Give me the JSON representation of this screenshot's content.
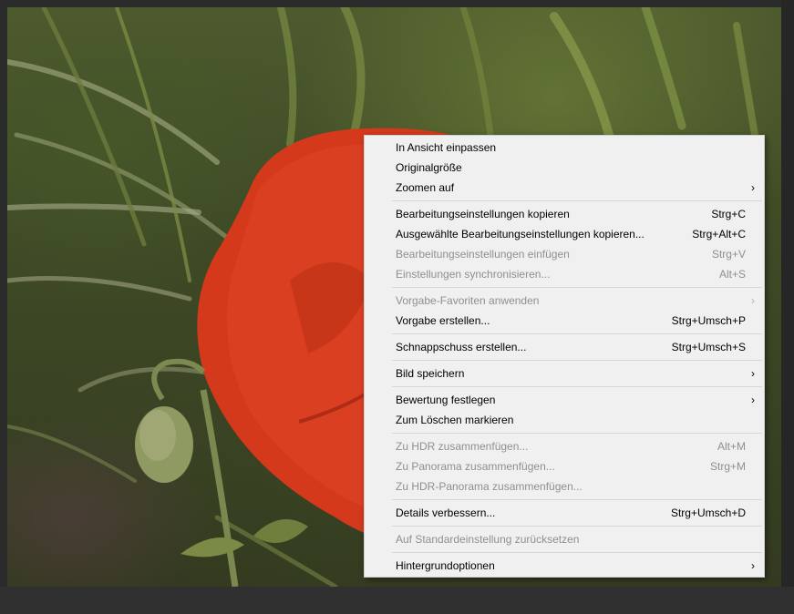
{
  "photo": {
    "subject": "red-poppy-flower"
  },
  "colors": {
    "menu_bg": "#f0f0f0",
    "menu_text": "#000000",
    "menu_disabled_text": "#8f8f8f",
    "poppy_red": "#d63a1c",
    "frame_bg": "#2b2b2b"
  },
  "context_menu": {
    "groups": [
      [
        {
          "label": "In Ansicht einpassen",
          "shortcut": "",
          "submenu": false,
          "disabled": false
        },
        {
          "label": "Originalgröße",
          "shortcut": "",
          "submenu": false,
          "disabled": false
        },
        {
          "label": "Zoomen auf",
          "shortcut": "",
          "submenu": true,
          "disabled": false
        }
      ],
      [
        {
          "label": "Bearbeitungseinstellungen kopieren",
          "shortcut": "Strg+C",
          "submenu": false,
          "disabled": false
        },
        {
          "label": "Ausgewählte Bearbeitungseinstellungen kopieren...",
          "shortcut": "Strg+Alt+C",
          "submenu": false,
          "disabled": false
        },
        {
          "label": "Bearbeitungseinstellungen einfügen",
          "shortcut": "Strg+V",
          "submenu": false,
          "disabled": true
        },
        {
          "label": "Einstellungen synchronisieren...",
          "shortcut": "Alt+S",
          "submenu": false,
          "disabled": true
        }
      ],
      [
        {
          "label": "Vorgabe-Favoriten anwenden",
          "shortcut": "",
          "submenu": true,
          "disabled": true
        },
        {
          "label": "Vorgabe erstellen...",
          "shortcut": "Strg+Umsch+P",
          "submenu": false,
          "disabled": false
        }
      ],
      [
        {
          "label": "Schnappschuss erstellen...",
          "shortcut": "Strg+Umsch+S",
          "submenu": false,
          "disabled": false
        }
      ],
      [
        {
          "label": "Bild speichern",
          "shortcut": "",
          "submenu": true,
          "disabled": false
        }
      ],
      [
        {
          "label": "Bewertung festlegen",
          "shortcut": "",
          "submenu": true,
          "disabled": false
        },
        {
          "label": "Zum Löschen markieren",
          "shortcut": "",
          "submenu": false,
          "disabled": false
        }
      ],
      [
        {
          "label": "Zu HDR zusammenfügen...",
          "shortcut": "Alt+M",
          "submenu": false,
          "disabled": true
        },
        {
          "label": "Zu Panorama zusammenfügen...",
          "shortcut": "Strg+M",
          "submenu": false,
          "disabled": true
        },
        {
          "label": "Zu HDR-Panorama zusammenfügen...",
          "shortcut": "",
          "submenu": false,
          "disabled": true
        }
      ],
      [
        {
          "label": "Details verbessern...",
          "shortcut": "Strg+Umsch+D",
          "submenu": false,
          "disabled": false
        }
      ],
      [
        {
          "label": "Auf Standardeinstellung zurücksetzen",
          "shortcut": "",
          "submenu": false,
          "disabled": true
        }
      ],
      [
        {
          "label": "Hintergrundoptionen",
          "shortcut": "",
          "submenu": true,
          "disabled": false
        }
      ]
    ],
    "submenu_icon": "chevron-right-icon"
  }
}
